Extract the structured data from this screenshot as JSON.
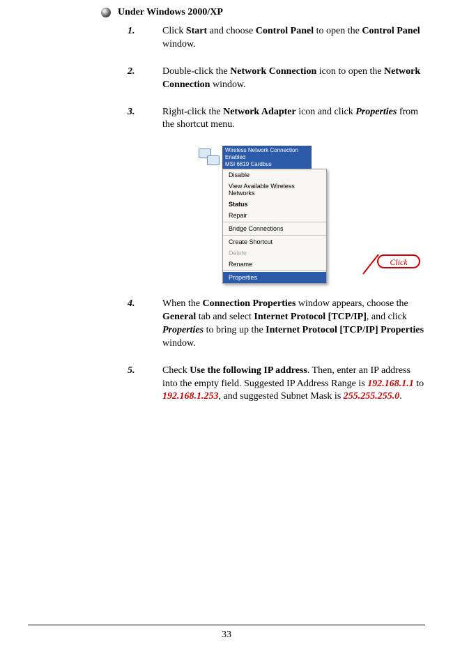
{
  "heading": "Under Windows 2000/XP",
  "steps": {
    "s1": {
      "num": "1.",
      "t1": "Click ",
      "b1": "Start",
      "t2": " and choose ",
      "b2": "Control Panel",
      "t3": " to open the ",
      "b3": "Control Panel",
      "t4": " window."
    },
    "s2": {
      "num": "2.",
      "t1": "Double-click the ",
      "b1": "Network Connection",
      "t2": " icon to open the ",
      "b2": "Network Connection",
      "t3": " window."
    },
    "s3": {
      "num": "3.",
      "t1": "Right-click the ",
      "b1": "Network Adapter",
      "t2": " icon and click ",
      "bi1": "Properties",
      "t3": " from the shortcut menu."
    },
    "s4": {
      "num": "4.",
      "t1": "When the ",
      "b1": "Connection Properties",
      "t2": " window appears, choose the ",
      "b2": "General",
      "t3": " tab and select ",
      "b3": "Internet Protocol [TCP/IP]",
      "t4": ", and click ",
      "bi1": "Properties",
      "t5": " to bring up the ",
      "b4": "Internet Protocol [TCP/IP] Properties",
      "t6": " window."
    },
    "s5": {
      "num": "5.",
      "t1": "Check ",
      "b1": "Use the following IP address",
      "t2": ".  Then, enter an IP address into the empty field.  Suggested IP Address Range is ",
      "r1": "192.168.1.1",
      "t3": " to ",
      "r2": "192.168.1.253",
      "t4": ", and suggested Subnet Mask is ",
      "r3": "255.255.255.0",
      "t5": "."
    }
  },
  "fig": {
    "conn_line1": "Wireless Network Connection",
    "conn_line2": "Enabled",
    "conn_line3": "MSI 6819 Cardbus",
    "menu": {
      "disable": "Disable",
      "view": "View Available Wireless Networks",
      "status": "Status",
      "repair": "Repair",
      "bridge": "Bridge Connections",
      "shortcut": "Create Shortcut",
      "delete": "Delete",
      "rename": "Rename",
      "properties": "Properties"
    },
    "callout": "Click"
  },
  "page_number": "33"
}
